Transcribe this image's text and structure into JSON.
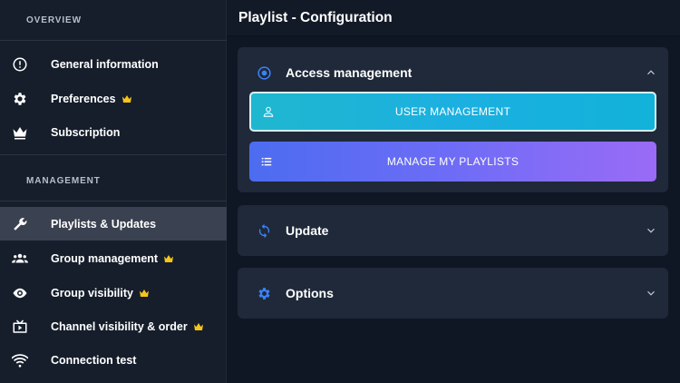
{
  "sidebar": {
    "overview_header": "OVERVIEW",
    "management_header": "MANAGEMENT",
    "items": [
      {
        "label": "General information",
        "icon": "info-icon",
        "crown": false
      },
      {
        "label": "Preferences",
        "icon": "gear-icon",
        "crown": true
      },
      {
        "label": "Subscription",
        "icon": "crown-icon",
        "crown": false
      },
      {
        "label": "Playlists & Updates",
        "icon": "wrench-icon",
        "crown": false,
        "active": true
      },
      {
        "label": "Group management",
        "icon": "group-icon",
        "crown": true
      },
      {
        "label": "Group visibility",
        "icon": "eye-icon",
        "crown": true
      },
      {
        "label": "Channel visibility & order",
        "icon": "tv-icon",
        "crown": true
      },
      {
        "label": "Connection test",
        "icon": "wifi-icon",
        "crown": false
      }
    ]
  },
  "header": {
    "title": "Playlist - Configuration"
  },
  "panels": {
    "access": {
      "title": "Access management",
      "expanded": true
    },
    "update": {
      "title": "Update",
      "expanded": false
    },
    "options": {
      "title": "Options",
      "expanded": false
    }
  },
  "buttons": {
    "user_management": "USER MANAGEMENT",
    "manage_playlists": "MANAGE MY PLAYLISTS"
  },
  "colors": {
    "accent_blue": "#3b82f6",
    "crown_gold": "#f5c518",
    "user_btn": "#1fb7cf",
    "playlist_btn_start": "#4c6cf0",
    "playlist_btn_end": "#9a6bf6"
  }
}
